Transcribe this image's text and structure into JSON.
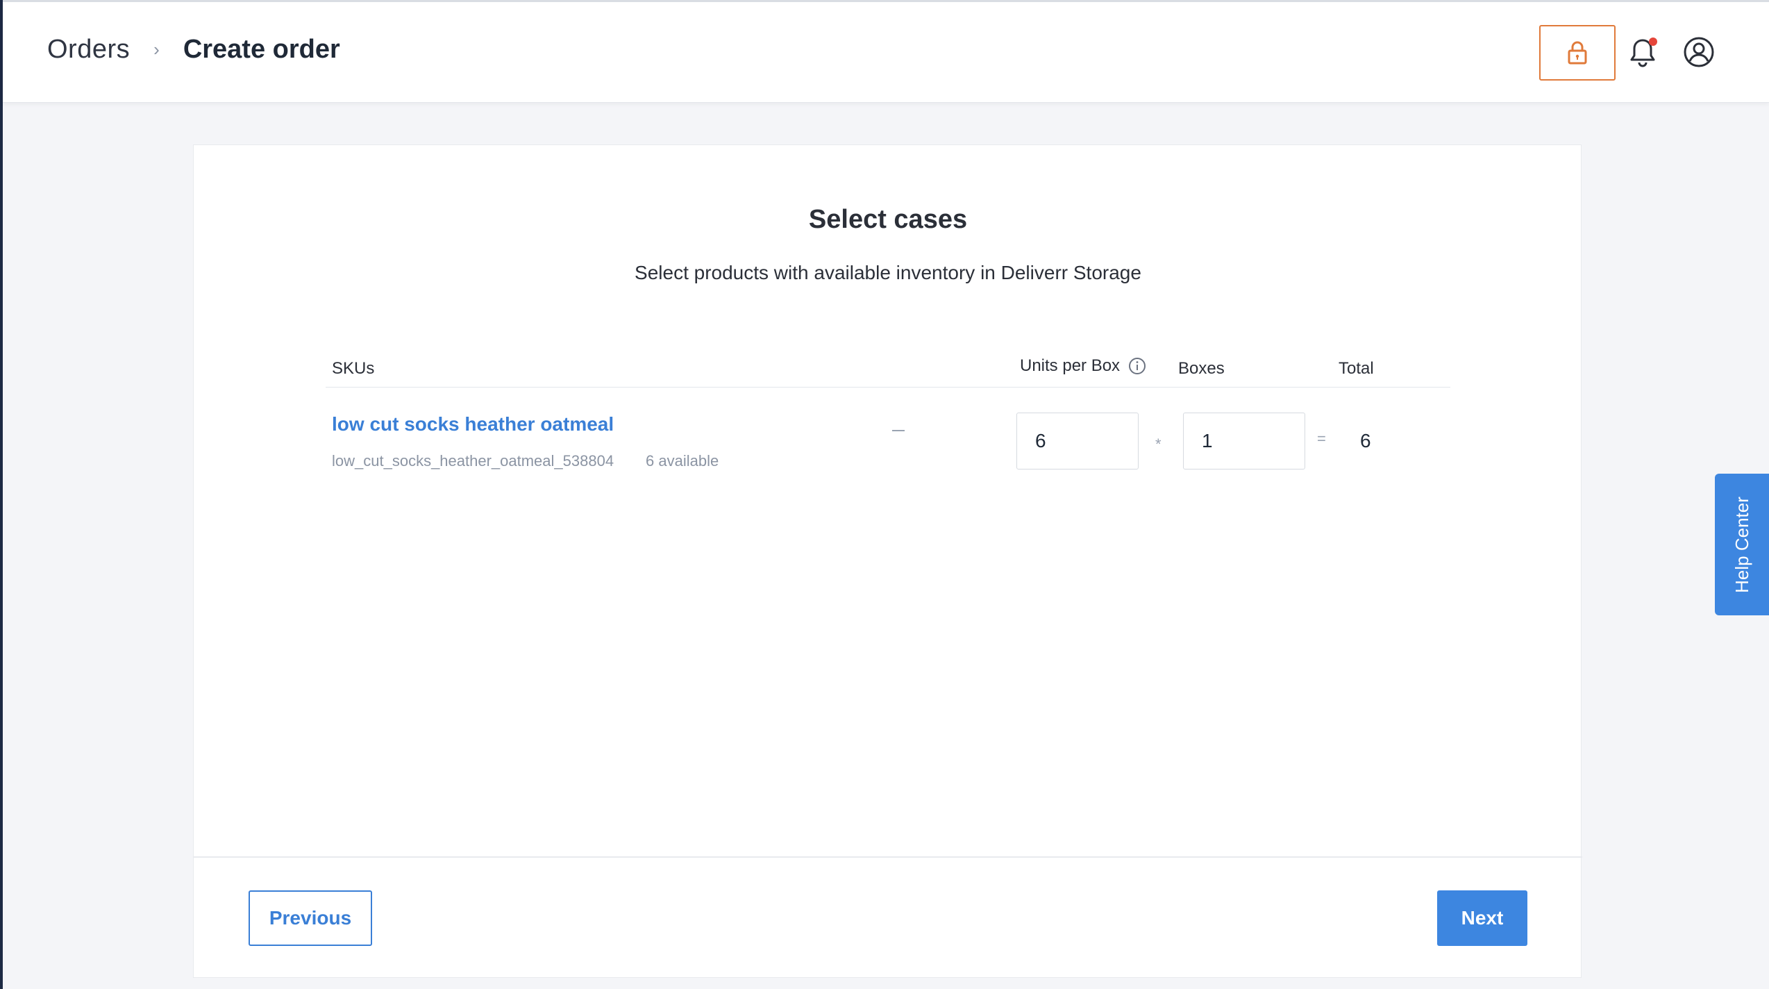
{
  "header": {
    "breadcrumb": {
      "parent": "Orders",
      "separator": "›",
      "current": "Create order"
    }
  },
  "card": {
    "title": "Select cases",
    "subtitle": "Select products with available inventory in Deliverr Storage",
    "columns": {
      "skus": "SKUs",
      "units_per_box": "Units per Box",
      "boxes": "Boxes",
      "total": "Total"
    },
    "rows": [
      {
        "name": "low cut socks heather oatmeal",
        "sku": "low_cut_socks_heather_oatmeal_538804",
        "available": "6 available",
        "units_per_box": "6",
        "multiply": "*",
        "boxes": "1",
        "equals": "=",
        "total": "6"
      }
    ],
    "buttons": {
      "previous": "Previous",
      "next": "Next"
    }
  },
  "help_center": {
    "label": "Help Center"
  },
  "colors": {
    "accent": "#3d86e0",
    "link": "#3a7fd6",
    "lock": "#e07a3a",
    "notification": "#e5453a"
  }
}
